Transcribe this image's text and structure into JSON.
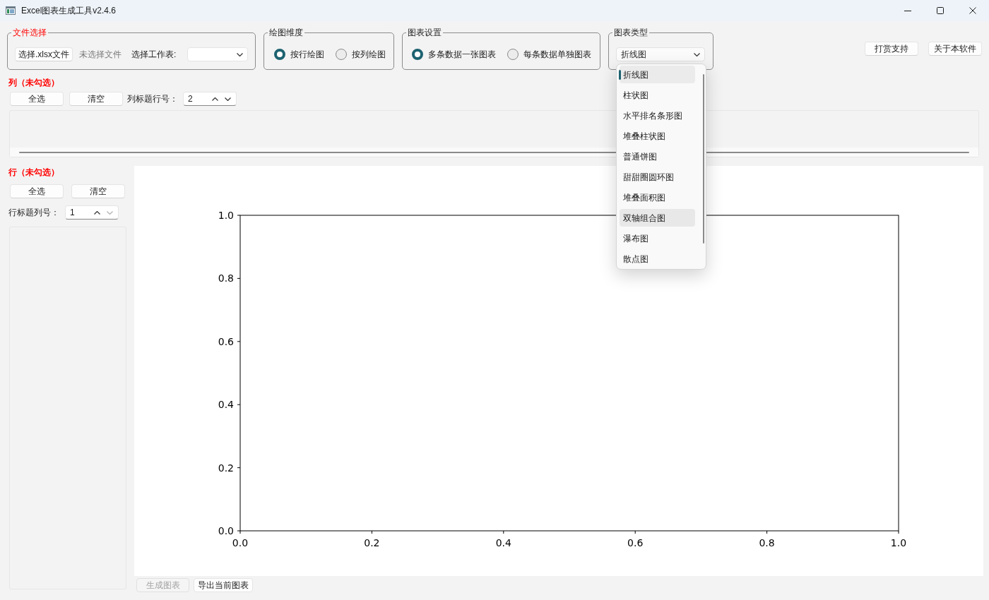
{
  "window": {
    "title": "Excel图表生成工具v2.4.6"
  },
  "file_group": {
    "legend": "文件选择",
    "alert": true,
    "choose_button": "选择.xlsx文件",
    "file_status": "未选择文件",
    "sheet_label": "选择工作表:"
  },
  "dimension_group": {
    "legend": "绘图维度",
    "alert": false,
    "options": [
      {
        "label": "按行绘图",
        "selected": true
      },
      {
        "label": "按列绘图",
        "selected": false
      }
    ]
  },
  "settings_group": {
    "legend": "图表设置",
    "alert": false,
    "options": [
      {
        "label": "多条数据一张图表",
        "selected": true
      },
      {
        "label": "每条数据单独图表",
        "selected": false
      }
    ]
  },
  "type_group": {
    "legend": "图表类型",
    "alert": false,
    "value": "折线图",
    "expanded": true,
    "options": [
      {
        "label": "折线图",
        "selected": true,
        "hovered": false
      },
      {
        "label": "柱状图",
        "selected": false,
        "hovered": false
      },
      {
        "label": "水平排名条形图",
        "selected": false,
        "hovered": false
      },
      {
        "label": "堆叠柱状图",
        "selected": false,
        "hovered": false
      },
      {
        "label": "普通饼图",
        "selected": false,
        "hovered": false
      },
      {
        "label": "甜甜圈圆环图",
        "selected": false,
        "hovered": false
      },
      {
        "label": "堆叠面积图",
        "selected": false,
        "hovered": false
      },
      {
        "label": "双轴组合图",
        "selected": false,
        "hovered": true
      },
      {
        "label": "瀑布图",
        "selected": false,
        "hovered": false
      },
      {
        "label": "散点图",
        "selected": false,
        "hovered": false
      }
    ]
  },
  "top_buttons": [
    "打赏支持",
    "关于本软件"
  ],
  "columns": {
    "title": "列（未勾选）",
    "alert": true,
    "buttons": [
      "全选",
      "清空"
    ],
    "spin": {
      "label": "列标题行号：",
      "value": "2",
      "can_decrease": true
    }
  },
  "rows": {
    "title": "行（未勾选）",
    "alert": true,
    "buttons": [
      "全选",
      "清空"
    ],
    "spin": {
      "label": "行标题列号：",
      "value": "1",
      "can_decrease": false
    }
  },
  "chart": {
    "chart_data": {
      "type": "line",
      "xlim": [
        0,
        1
      ],
      "ylim": [
        0,
        1
      ],
      "xticks": [
        {
          "value": 0,
          "label": "0.0"
        },
        {
          "value": 0.2,
          "label": "0.2"
        },
        {
          "value": 0.4,
          "label": "0.4"
        },
        {
          "value": 0.6,
          "label": "0.6"
        },
        {
          "value": 0.8,
          "label": "0.8"
        },
        {
          "value": 1,
          "label": "1.0"
        }
      ],
      "yticks": [
        {
          "value": 0,
          "label": "0.0"
        },
        {
          "value": 0.2,
          "label": "0.2"
        },
        {
          "value": 0.4,
          "label": "0.4"
        },
        {
          "value": 0.6,
          "label": "0.6"
        },
        {
          "value": 0.8,
          "label": "0.8"
        },
        {
          "value": 1,
          "label": "1.0"
        }
      ]
    }
  },
  "bottom_buttons": [
    {
      "label": "生成图表",
      "disabled": true
    },
    {
      "label": "导出当前图表",
      "disabled": false
    }
  ]
}
